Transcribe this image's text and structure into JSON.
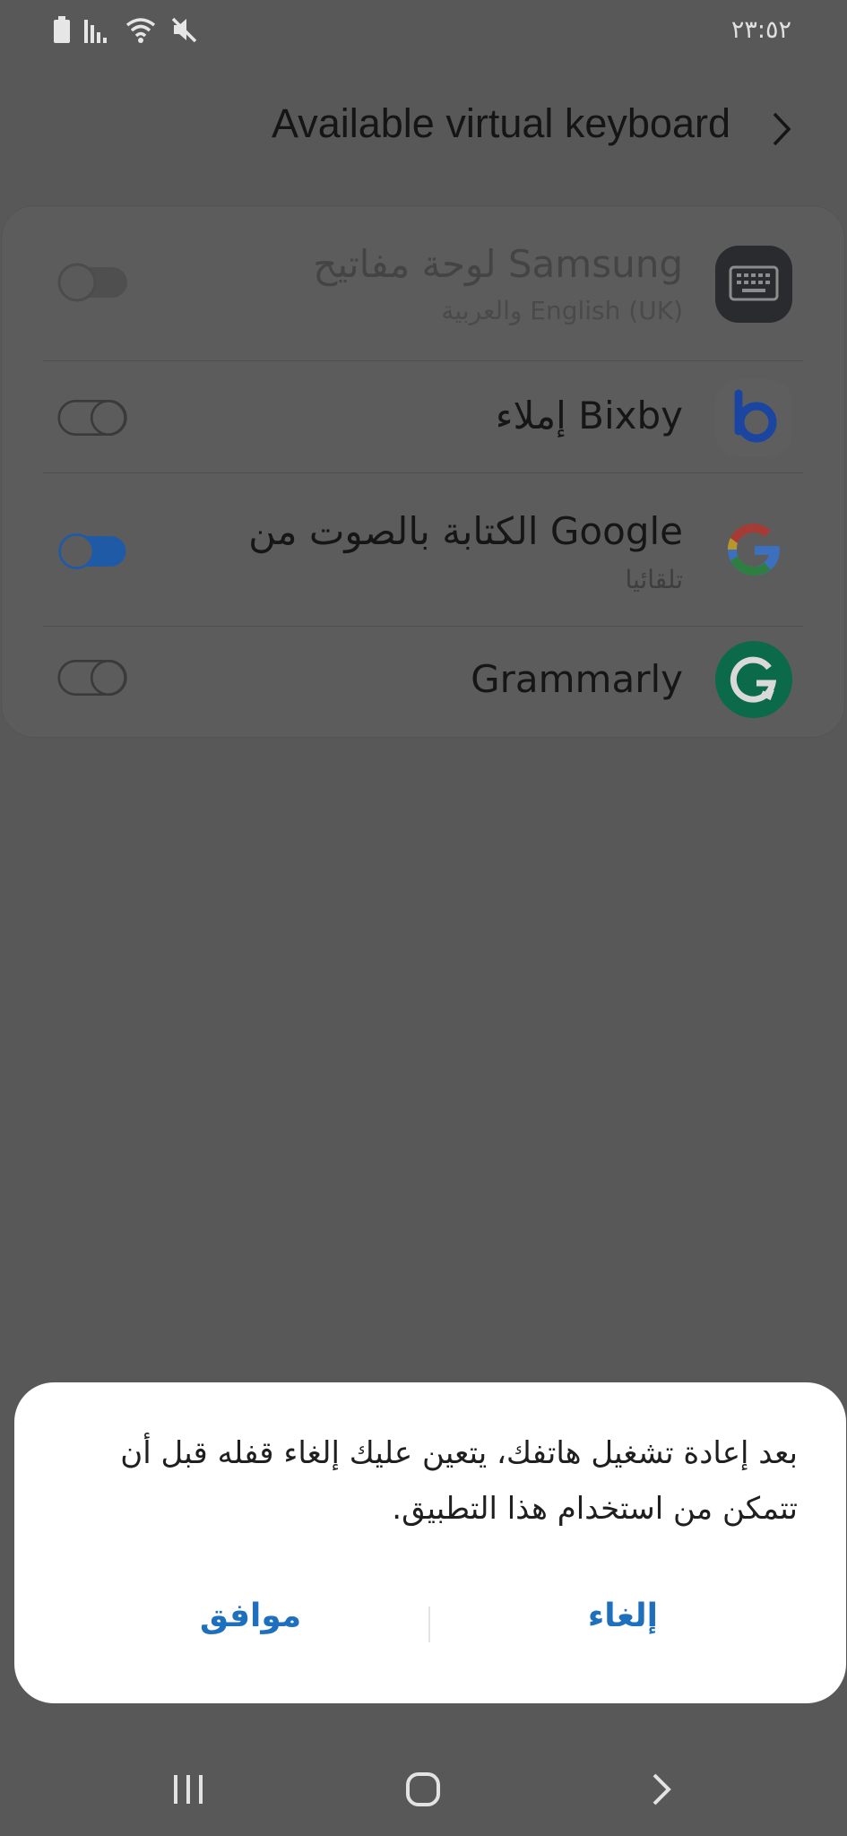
{
  "status_bar": {
    "time": "٢٣:٥٢",
    "icons": [
      "battery-icon",
      "signal-icon",
      "wifi-icon",
      "mute-icon"
    ]
  },
  "header": {
    "title": "Available virtual keyboard",
    "chevron": "chevron-right-icon"
  },
  "keyboards": [
    {
      "title": "لوحة مفاتيح Samsung",
      "subtitle": "والعربية English (UK)",
      "icon": "samsung-keyboard-icon",
      "enabled": false,
      "disabled_state": true
    },
    {
      "title": "إملاء Bixby",
      "subtitle": "",
      "icon": "bixby-icon",
      "enabled": false,
      "disabled_state": false
    },
    {
      "title": "الكتابة بالصوت من Google",
      "subtitle": "تلقائيا",
      "icon": "google-icon",
      "enabled": true,
      "disabled_state": false
    },
    {
      "title": "Grammarly",
      "subtitle": "",
      "icon": "grammarly-icon",
      "enabled": false,
      "disabled_state": false
    }
  ],
  "dialog": {
    "message": "بعد إعادة تشغيل هاتفك، يتعين عليك إلغاء قفله قبل أن تتمكن من استخدام هذا التطبيق.",
    "cancel_label": "إلغاء",
    "ok_label": "موافق"
  },
  "nav_bar": {
    "buttons": [
      "recents-icon",
      "home-icon",
      "back-icon"
    ]
  },
  "colors": {
    "scrim": "#585858",
    "accent": "#1f6fbf",
    "toggle_on": "#1f5aa6"
  }
}
